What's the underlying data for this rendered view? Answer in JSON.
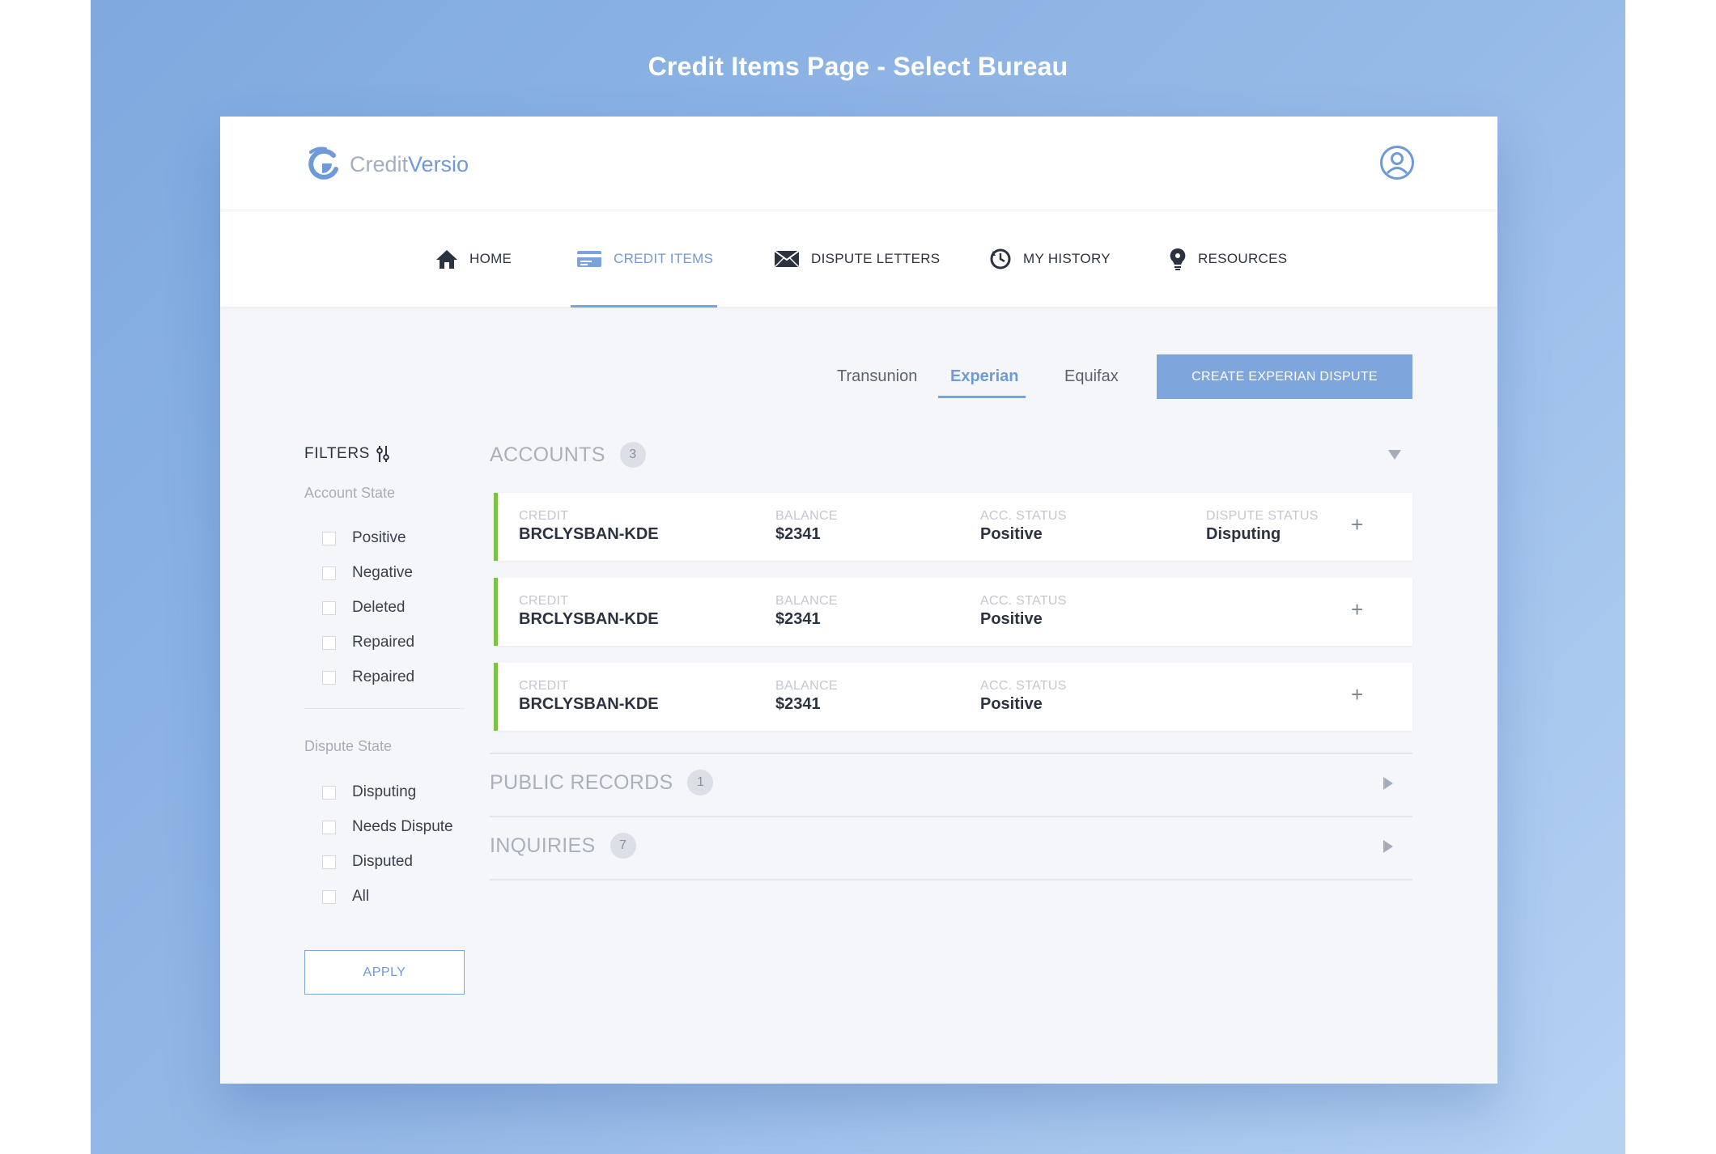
{
  "page_title": "Credit Items Page - Select Bureau",
  "brand": {
    "name_part1": "Credit",
    "name_part2": "Versio",
    "accent_color": "#6f9ad8",
    "card_accent_color": "#7cc243"
  },
  "nav": {
    "items": [
      {
        "label": "HOME",
        "icon": "home-icon"
      },
      {
        "label": "CREDIT ITEMS",
        "icon": "credit-card-icon",
        "active": true
      },
      {
        "label": "DISPUTE LETTERS",
        "icon": "envelope-icon"
      },
      {
        "label": "MY HISTORY",
        "icon": "history-icon"
      },
      {
        "label": "RESOURCES",
        "icon": "lightbulb-icon"
      }
    ]
  },
  "bureaus": {
    "tabs": [
      "Transunion",
      "Experian",
      "Equifax"
    ],
    "selected": "Experian",
    "create_button": "CREATE EXPERIAN DISPUTE"
  },
  "filters": {
    "title": "FILTERS",
    "account_state": {
      "label": "Account State",
      "options": [
        "Positive",
        "Negative",
        "Deleted",
        "Repaired",
        "Repaired"
      ]
    },
    "dispute_state": {
      "label": "Dispute State",
      "options": [
        "Disputing",
        "Needs Dispute",
        "Disputed",
        "All"
      ]
    },
    "apply_label": "APPLY"
  },
  "sections": {
    "accounts": {
      "title": "ACCOUNTS",
      "count": "3",
      "expanded": true,
      "items": [
        {
          "credit_label": "CREDIT",
          "credit": "BRCLYSBAN-KDE",
          "balance_label": "BALANCE",
          "balance": "$2341",
          "status_label": "ACC. STATUS",
          "status": "Positive",
          "dispute_label": "DISPUTE STATUS",
          "dispute": "Disputing"
        },
        {
          "credit_label": "CREDIT",
          "credit": "BRCLYSBAN-KDE",
          "balance_label": "BALANCE",
          "balance": "$2341",
          "status_label": "ACC. STATUS",
          "status": "Positive"
        },
        {
          "credit_label": "CREDIT",
          "credit": "BRCLYSBAN-KDE",
          "balance_label": "BALANCE",
          "balance": "$2341",
          "status_label": "ACC. STATUS",
          "status": "Positive"
        }
      ]
    },
    "public_records": {
      "title": "PUBLIC RECORDS",
      "count": "1",
      "expanded": false
    },
    "inquiries": {
      "title": "INQUIRIES",
      "count": "7",
      "expanded": false
    }
  }
}
